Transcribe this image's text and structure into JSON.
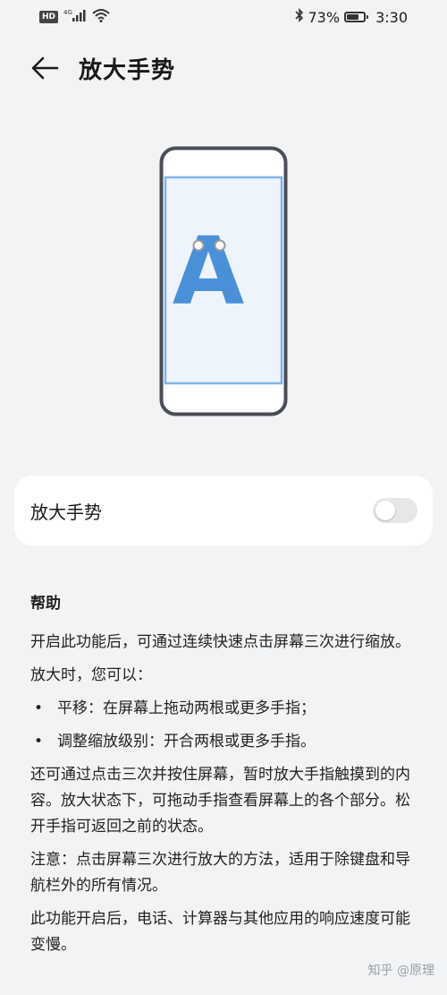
{
  "status_bar": {
    "network_badge": "HD",
    "network_gen": "4G",
    "battery_percent": "73%",
    "battery_level": 0.73,
    "time": "3:30"
  },
  "appbar": {
    "title": "放大手势"
  },
  "illustration": {
    "letter": "A",
    "accent_color": "#4a90d9",
    "frame_color": "#4a4d55"
  },
  "setting": {
    "label": "放大手势",
    "enabled": false
  },
  "help": {
    "title": "帮助",
    "para1": "开启此功能后，可通过连续快速点击屏幕三次进行缩放。",
    "para2": "放大时，您可以：",
    "bullet_symbol": "•",
    "bullet1": "平移：在屏幕上拖动两根或更多手指；",
    "bullet2": "调整缩放级别：开合两根或更多手指。",
    "para3": "还可通过点击三次并按住屏幕，暂时放大手指触摸到的内容。放大状态下，可拖动手指查看屏幕上的各个部分。松开手指可返回之前的状态。",
    "para4": "注意：点击屏幕三次进行放大的方法，适用于除键盘和导航栏外的所有情况。",
    "para5": "此功能开启后，电话、计算器与其他应用的响应速度可能变慢。"
  },
  "watermark": "知乎 @原理"
}
